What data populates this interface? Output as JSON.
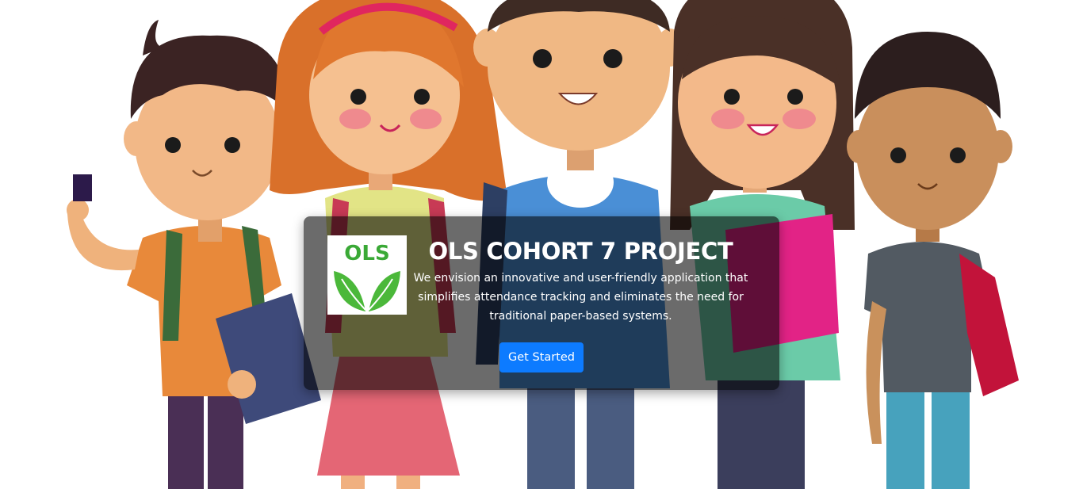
{
  "hero": {
    "title": "OLS COHORT 7 PROJECT",
    "description": "We envision an innovative and user-friendly application that simplifies attendance tracking and eliminates the need for traditional paper-based systems.",
    "cta_label": "Get Started",
    "logo_text": "OLS"
  },
  "colors": {
    "card_overlay": "#000000",
    "cta_blue": "#0d7bff",
    "logo_green": "#3aa936"
  },
  "illustration": {
    "subject": "five cartoon students with backpacks"
  }
}
